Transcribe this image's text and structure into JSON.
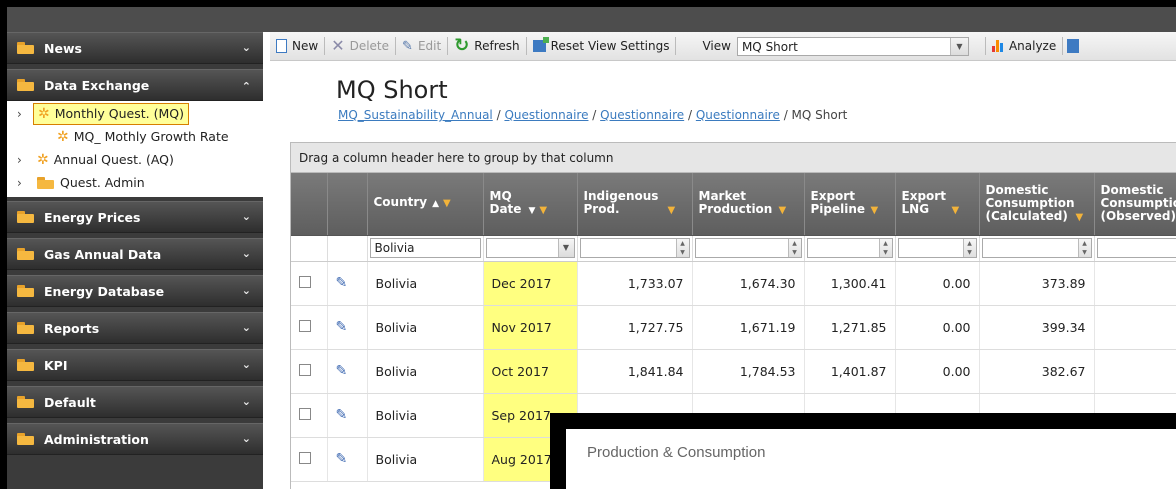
{
  "sidebar": {
    "sections": [
      {
        "label": "News",
        "chevron": "⌄"
      },
      {
        "label": "Data Exchange",
        "chevron": "⌃"
      },
      {
        "label": "Energy Prices",
        "chevron": "⌄"
      },
      {
        "label": "Gas Annual Data",
        "chevron": "⌄"
      },
      {
        "label": "Energy Database",
        "chevron": "⌄"
      },
      {
        "label": "Reports",
        "chevron": "⌄"
      },
      {
        "label": "KPI",
        "chevron": "⌄"
      },
      {
        "label": "Default",
        "chevron": "⌄"
      },
      {
        "label": "Administration",
        "chevron": "⌄"
      }
    ],
    "data_exchange_items": [
      {
        "label": "Monthly Quest. (MQ)"
      },
      {
        "label": "MQ_ Mothly Growth Rate"
      },
      {
        "label": "Annual Quest. (AQ)"
      },
      {
        "label": "Quest. Admin"
      }
    ],
    "arrow_glyph": "›"
  },
  "toolbar": {
    "new_label": "New",
    "delete_label": "Delete",
    "edit_label": "Edit",
    "refresh_label": "Refresh",
    "reset_label": "Reset View Settings",
    "view_label": "View",
    "view_value": "MQ Short",
    "analyze_label": "Analyze",
    "dropdown_glyph": "▼"
  },
  "page": {
    "title": "MQ Short",
    "breadcrumb": {
      "link1": "MQ_Sustainability_Annual",
      "link2": "Questionnaire",
      "link3": "Questionnaire",
      "link4": "Questionnaire",
      "current": "MQ Short",
      "sep": " / "
    }
  },
  "grid": {
    "group_hint": "Drag a column header here to group by that column",
    "columns": [
      {
        "label": "Country"
      },
      {
        "label": "MQ Date"
      },
      {
        "label": "Indigenous Prod."
      },
      {
        "label": "Market Production"
      },
      {
        "label": "Export Pipeline"
      },
      {
        "label": "Export LNG"
      },
      {
        "label": "Domestic Consumption (Calculated)"
      },
      {
        "label": "Domestic Consumption (Observed)"
      }
    ],
    "filter_country": "Bolivia",
    "rows": [
      {
        "country": "Bolivia",
        "date": "Dec 2017",
        "indigenous": "1,733.07",
        "market": "1,674.30",
        "pipeline": "1,300.41",
        "lng": "0.00",
        "domestic_calc": "373.89"
      },
      {
        "country": "Bolivia",
        "date": "Nov 2017",
        "indigenous": "1,727.75",
        "market": "1,671.19",
        "pipeline": "1,271.85",
        "lng": "0.00",
        "domestic_calc": "399.34"
      },
      {
        "country": "Bolivia",
        "date": "Oct 2017",
        "indigenous": "1,841.84",
        "market": "1,784.53",
        "pipeline": "1,401.87",
        "lng": "0.00",
        "domestic_calc": "382.67"
      },
      {
        "country": "Bolivia",
        "date": "Sep 2017",
        "indigenous": "",
        "market": "",
        "pipeline": "",
        "lng": "",
        "domestic_calc": ""
      },
      {
        "country": "Bolivia",
        "date": "Aug 2017",
        "indigenous": "",
        "market": "",
        "pipeline": "",
        "lng": "",
        "domestic_calc": ""
      }
    ],
    "sort_glyph": "▲",
    "sort_desc_glyph": "▼",
    "filter_glyph": "▼",
    "pencil_glyph": "✎"
  },
  "dialog": {
    "title": "Production & Consumption"
  },
  "colors": {
    "highlight": "#ffff80",
    "link": "#3b7bbf",
    "header_bg": "#6b6b6b",
    "sidebar_bg": "#3b3b3b",
    "folder": "#f5b840"
  }
}
